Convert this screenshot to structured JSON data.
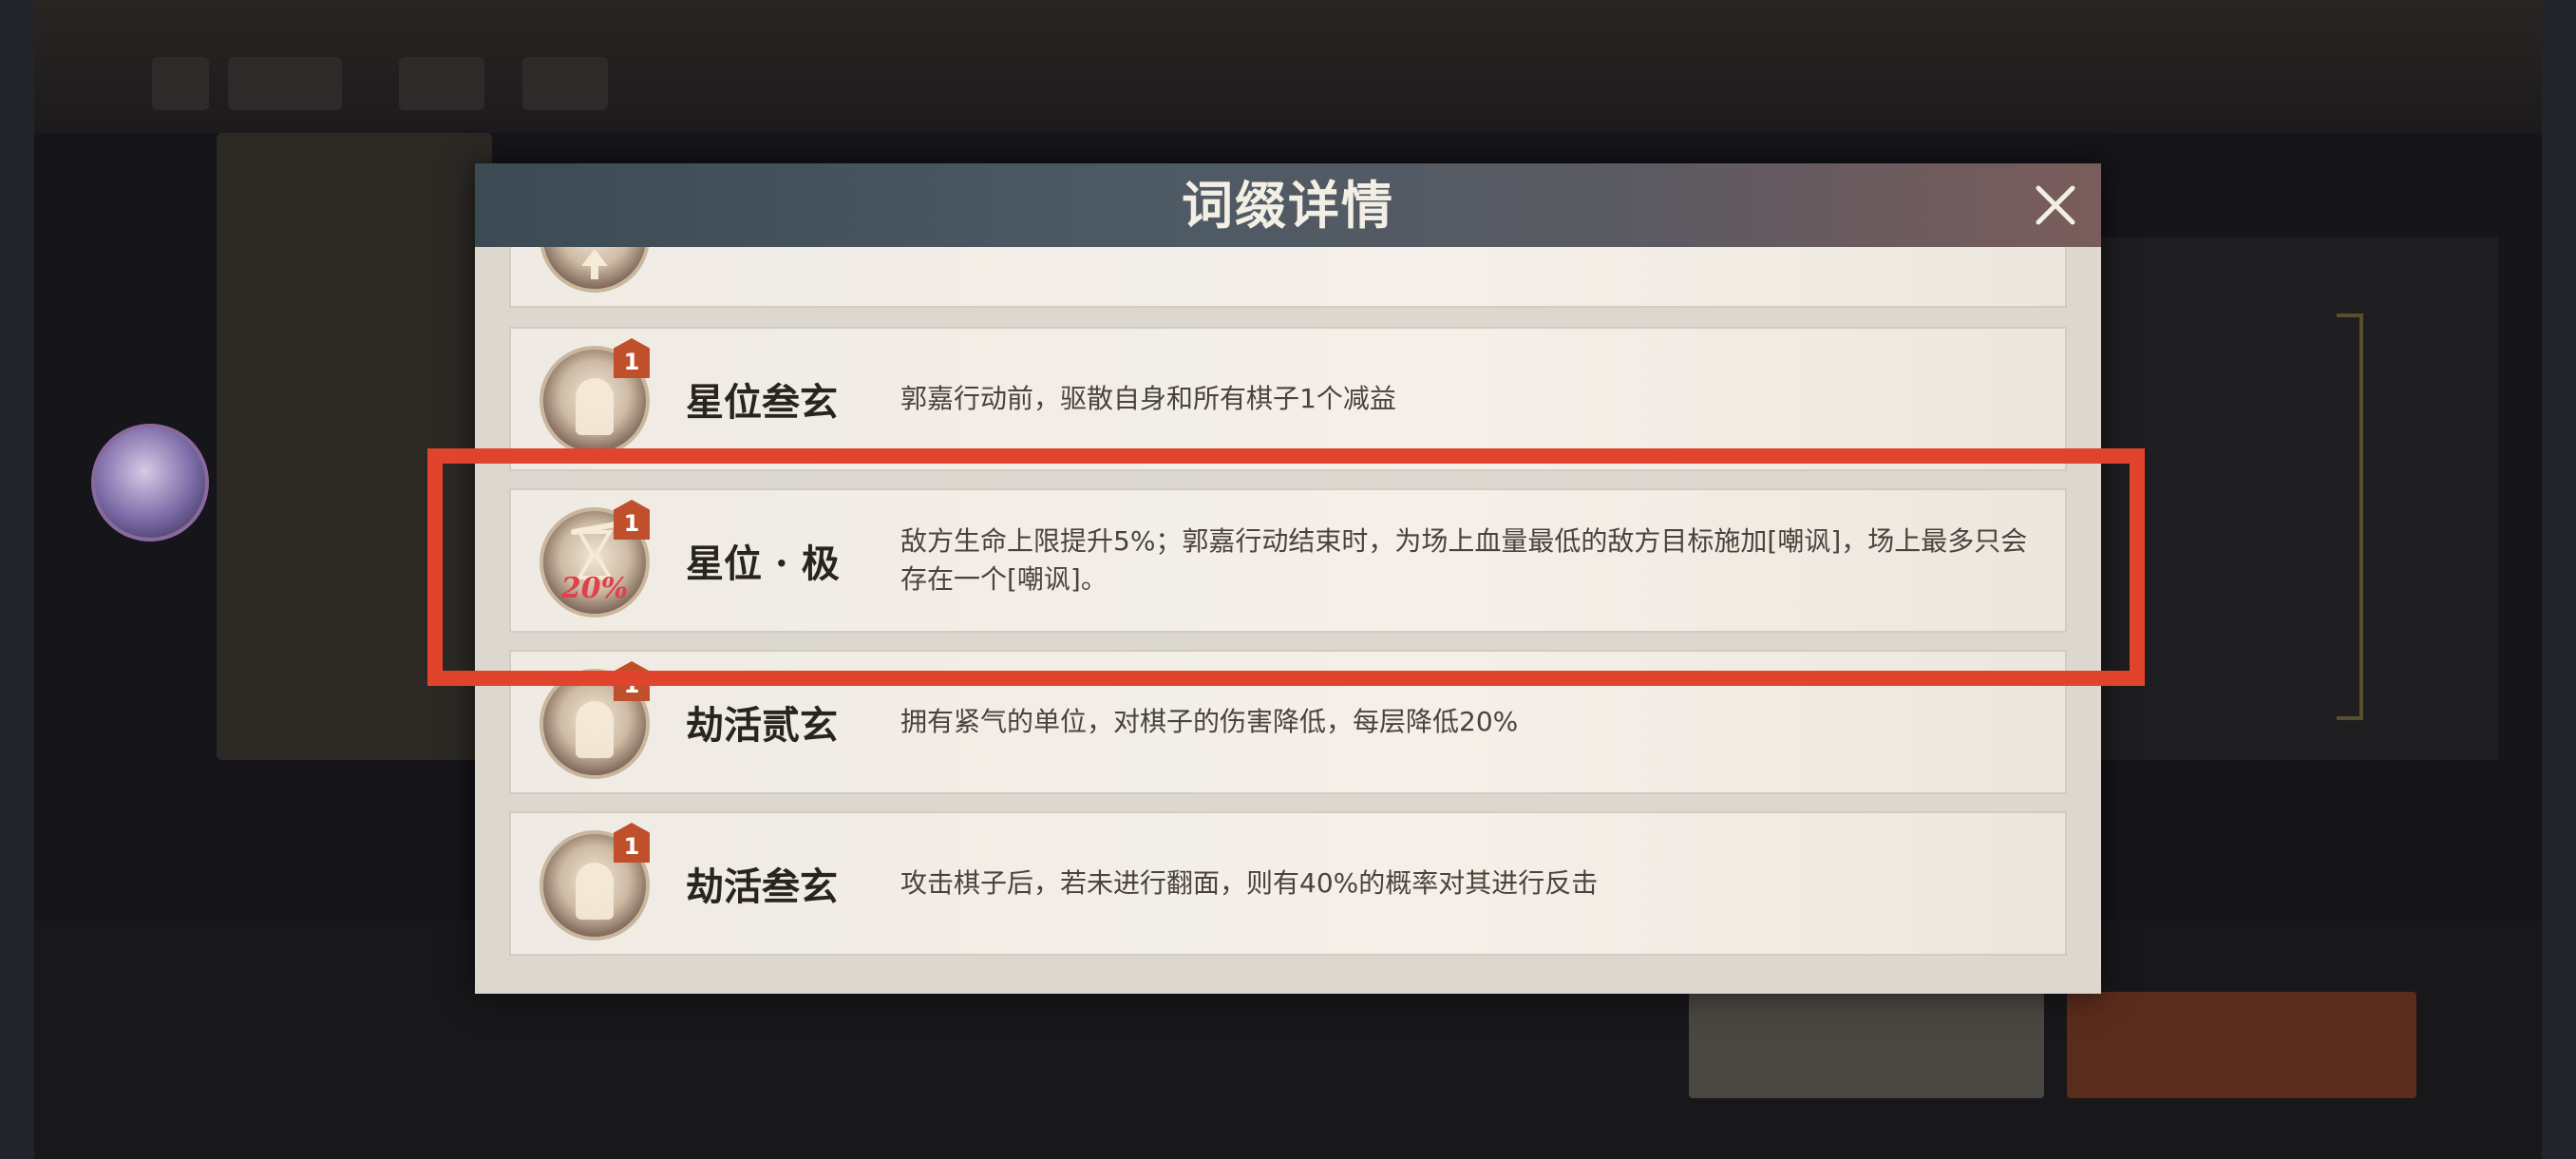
{
  "dialog": {
    "title": "词缀详情",
    "close_icon": "close-icon",
    "items": [
      {
        "name": "",
        "desc": "",
        "badge": "",
        "icon": "affix-upgrade-icon"
      },
      {
        "name": "星位叁玄",
        "desc": "郭嘉行动前，驱散自身和所有棋子1个减益",
        "badge": "1",
        "icon": "affix-figure-icon"
      },
      {
        "name": "星位 · 极",
        "desc": "敌方生命上限提升5%；郭嘉行动结束时，为场上血量最低的敌方目标施加[嘲讽]，场上最多只会存在一个[嘲讽]。",
        "badge": "1",
        "icon": "hourglass-icon",
        "icon_text": "20%"
      },
      {
        "name": "劫活贰玄",
        "desc": "拥有紧气的单位，对棋子的伤害降低，每层降低20%",
        "badge": "1",
        "icon": "affix-figure-icon"
      },
      {
        "name": "劫活叁玄",
        "desc": "攻击棋子后，若未进行翻面，则有40%的概率对其进行反击",
        "badge": "1",
        "icon": "affix-figure-icon"
      }
    ]
  },
  "highlight": {
    "color": "#e0442c",
    "target": "星位 · 极"
  },
  "colors": {
    "header_start": "#3c4a54",
    "header_end": "#7a5c5c",
    "badge": "#c0502c",
    "text": "#2a2420"
  }
}
